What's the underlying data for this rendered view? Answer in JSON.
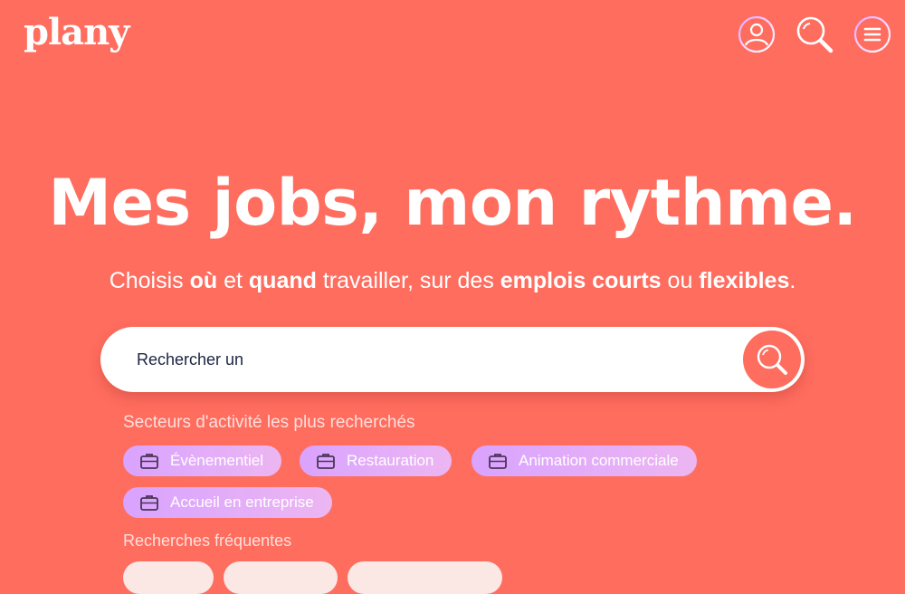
{
  "brand": {
    "logo_text": "plany"
  },
  "header": {
    "icons": [
      "user-icon",
      "search-icon",
      "menu-icon"
    ]
  },
  "hero": {
    "title": "Mes jobs, mon rythme.",
    "subtitle": {
      "p1": "Choisis ",
      "b1": "où",
      "p2": " et ",
      "b2": "quand",
      "p3": " travailler, sur des ",
      "b3": "emplois courts",
      "p4": " ou ",
      "b4": "flexibles",
      "p5": "."
    }
  },
  "search": {
    "placeholder": "Rechercher un"
  },
  "sectors": {
    "label": "Secteurs d'activité les plus recherchés",
    "items": [
      {
        "label": "Évènementiel",
        "icon": "briefcase-icon"
      },
      {
        "label": "Restauration",
        "icon": "briefcase-icon"
      },
      {
        "label": "Animation commerciale",
        "icon": "briefcase-icon"
      },
      {
        "label": "Accueil en entreprise",
        "icon": "briefcase-icon"
      }
    ]
  },
  "frequent": {
    "label": "Recherches fréquentes"
  },
  "colors": {
    "background": "#ff6d5f",
    "chip_gradient_start": "#d9a3ff",
    "chip_gradient_end": "#ecb6f2",
    "text_dark": "#1b2442"
  }
}
